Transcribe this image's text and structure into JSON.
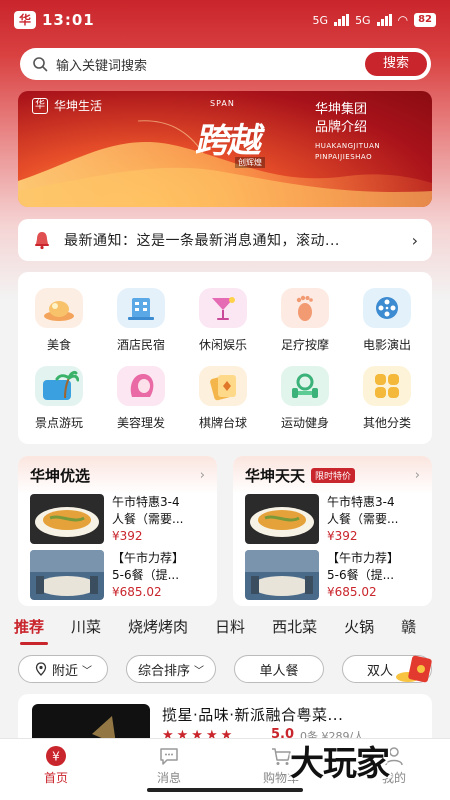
{
  "status_bar": {
    "app_badge": "华",
    "time": "13:01",
    "network_labels": [
      "5G",
      "5G"
    ],
    "battery": "82"
  },
  "search": {
    "placeholder": "输入关键词搜索",
    "button_label": "搜索"
  },
  "banner": {
    "brand": "华坤生活",
    "span_label": "SPAN",
    "calligraphy": "跨越",
    "calligraphy_sub": "创辉煌",
    "title_line1": "华坤集团",
    "title_line2": "品牌介绍",
    "pinyin_line1": "HUAKANGJITUAN",
    "pinyin_line2": "PINPAIJIESHAO"
  },
  "notice": {
    "text": "最新通知：这是一条最新消息通知，滚动...",
    "arrow": "›"
  },
  "categories": [
    {
      "label": "美食",
      "icon": "food-icon"
    },
    {
      "label": "酒店民宿",
      "icon": "hotel-icon"
    },
    {
      "label": "休闲娱乐",
      "icon": "cocktail-icon"
    },
    {
      "label": "足疗按摩",
      "icon": "foot-icon"
    },
    {
      "label": "电影演出",
      "icon": "film-reel-icon"
    },
    {
      "label": "景点游玩",
      "icon": "palm-tree-icon"
    },
    {
      "label": "美容理发",
      "icon": "hair-icon"
    },
    {
      "label": "棋牌台球",
      "icon": "cards-icon"
    },
    {
      "label": "运动健身",
      "icon": "dumbbell-icon"
    },
    {
      "label": "其他分类",
      "icon": "grid-icon"
    }
  ],
  "promos": [
    {
      "title": "华坤优选",
      "badge": "",
      "arrow": "›",
      "items": [
        {
          "name_line1": "午市特惠3-4",
          "name_line2": "人餐（需要...",
          "price": "¥392"
        },
        {
          "name_line1": "【午市力荐】",
          "name_line2": "5-6餐（提...",
          "price": "¥685.02"
        }
      ]
    },
    {
      "title": "华坤天天",
      "badge": "限时特价",
      "arrow": "›",
      "items": [
        {
          "name_line1": "午市特惠3-4",
          "name_line2": "人餐（需要...",
          "price": "¥392"
        },
        {
          "name_line1": "【午市力荐】",
          "name_line2": "5-6餐（提...",
          "price": "¥685.02"
        }
      ]
    }
  ],
  "tabs": [
    "推荐",
    "川菜",
    "烧烤烤肉",
    "日料",
    "西北菜",
    "火锅",
    "赣"
  ],
  "filters": {
    "nearby": "附近",
    "sort": "综合排序",
    "single": "单人餐",
    "double": "双人"
  },
  "store": {
    "name": "揽星·品味·新派融合粤菜...",
    "stars": "★★★★★",
    "score": "5.0",
    "meta": "0条  ¥289/人"
  },
  "bottom_nav": {
    "home": "首页",
    "messages": "消息",
    "cart": "购物车",
    "mine": "我的"
  },
  "watermark": "大玩家",
  "colors": {
    "brand_red": "#c9252c",
    "text_dark": "#222222",
    "muted": "#888888"
  }
}
